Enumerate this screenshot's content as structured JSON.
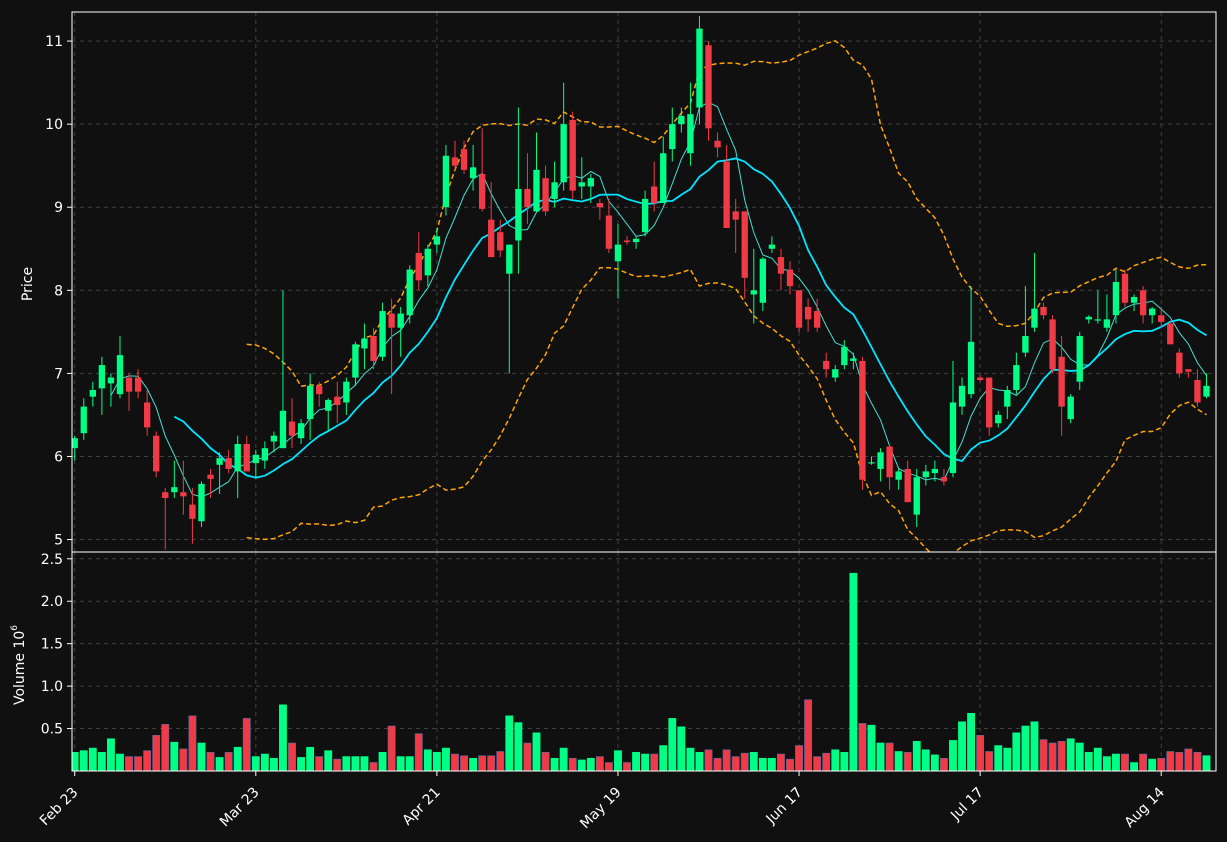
{
  "colors": {
    "background": "#101010",
    "up": "#00ff87",
    "down": "#f03a46",
    "grid": "#555555",
    "axis": "#ffffff",
    "ma_short": "#40e0d0",
    "ma_long": "#00e5ff",
    "band": "#ffa500"
  },
  "chart_data": {
    "type": "candlestick",
    "price_panel": {
      "ylabel": "Price",
      "ylim": [
        4.85,
        11.35
      ],
      "yticks": [
        5,
        6,
        7,
        8,
        9,
        10,
        11
      ],
      "grid": true
    },
    "volume_panel": {
      "ylabel": "Volume",
      "ylabel_exponent": "6",
      "ylim": [
        0,
        2.58
      ],
      "yticks": [
        0.5,
        1.0,
        1.5,
        2.0,
        2.5
      ],
      "grid": true
    },
    "x_ticks": [
      {
        "label": "Feb 23",
        "index": 0
      },
      {
        "label": "Mar 23",
        "index": 20
      },
      {
        "label": "Apr 21",
        "index": 40
      },
      {
        "label": "May 19",
        "index": 60
      },
      {
        "label": "Jun 17",
        "index": 80
      },
      {
        "label": "Jul 17",
        "index": 100
      },
      {
        "label": "Aug 14",
        "index": 120
      }
    ],
    "ohlcv": [
      [
        6.1,
        6.25,
        5.95,
        6.22,
        0.22
      ],
      [
        6.28,
        6.7,
        6.2,
        6.6,
        0.24
      ],
      [
        6.72,
        6.9,
        6.6,
        6.8,
        0.27
      ],
      [
        6.82,
        7.2,
        6.5,
        7.1,
        0.22
      ],
      [
        6.88,
        7.0,
        6.6,
        6.95,
        0.38
      ],
      [
        6.75,
        7.45,
        6.7,
        7.22,
        0.2
      ],
      [
        6.95,
        7.0,
        6.55,
        6.78,
        0.17
      ],
      [
        6.95,
        7.05,
        6.7,
        6.78,
        0.17
      ],
      [
        6.65,
        6.8,
        6.25,
        6.35,
        0.24
      ],
      [
        6.25,
        6.3,
        5.75,
        5.82,
        0.42
      ],
      [
        5.57,
        5.62,
        4.88,
        5.5,
        0.55
      ],
      [
        5.57,
        5.95,
        5.5,
        5.63,
        0.34
      ],
      [
        5.57,
        5.95,
        5.3,
        5.52,
        0.26
      ],
      [
        5.42,
        5.62,
        4.95,
        5.25,
        0.65
      ],
      [
        5.22,
        5.7,
        5.15,
        5.67,
        0.33
      ],
      [
        5.78,
        5.85,
        5.5,
        5.73,
        0.22
      ],
      [
        5.9,
        6.05,
        5.55,
        5.98,
        0.16
      ],
      [
        5.98,
        6.08,
        5.8,
        5.85,
        0.22
      ],
      [
        5.82,
        6.25,
        5.5,
        6.15,
        0.28
      ],
      [
        6.15,
        6.25,
        5.85,
        5.82,
        0.62
      ],
      [
        5.92,
        6.08,
        5.75,
        6.02,
        0.17
      ],
      [
        5.95,
        6.18,
        5.85,
        6.1,
        0.2
      ],
      [
        6.18,
        6.3,
        6.05,
        6.25,
        0.15
      ],
      [
        6.1,
        8.0,
        6.1,
        6.55,
        0.78
      ],
      [
        6.42,
        6.7,
        6.1,
        6.25,
        0.33
      ],
      [
        6.22,
        6.45,
        6.15,
        6.4,
        0.16
      ],
      [
        6.45,
        7.0,
        6.2,
        6.85,
        0.28
      ],
      [
        6.85,
        6.9,
        6.6,
        6.75,
        0.17
      ],
      [
        6.55,
        6.7,
        6.3,
        6.68,
        0.24
      ],
      [
        6.72,
        6.9,
        6.4,
        6.62,
        0.14
      ],
      [
        6.65,
        6.95,
        6.5,
        6.9,
        0.17
      ],
      [
        6.95,
        7.38,
        6.85,
        7.35,
        0.17
      ],
      [
        7.3,
        7.6,
        7.05,
        7.42,
        0.17
      ],
      [
        7.45,
        7.55,
        7.05,
        7.15,
        0.1
      ],
      [
        7.2,
        7.85,
        7.15,
        7.75,
        0.22
      ],
      [
        7.72,
        7.9,
        6.75,
        7.55,
        0.53
      ],
      [
        7.55,
        7.8,
        7.2,
        7.72,
        0.17
      ],
      [
        7.7,
        8.3,
        7.6,
        8.25,
        0.17
      ],
      [
        8.45,
        8.7,
        8.0,
        8.12,
        0.44
      ],
      [
        8.18,
        8.55,
        8.05,
        8.5,
        0.25
      ],
      [
        8.55,
        8.75,
        8.45,
        8.65,
        0.22
      ],
      [
        9.0,
        9.75,
        8.9,
        9.62,
        0.27
      ],
      [
        9.6,
        9.8,
        9.45,
        9.5,
        0.2
      ],
      [
        9.7,
        9.8,
        9.4,
        9.45,
        0.18
      ],
      [
        9.35,
        9.75,
        9.2,
        9.48,
        0.15
      ],
      [
        9.4,
        9.95,
        8.95,
        8.98,
        0.18
      ],
      [
        8.85,
        9.3,
        8.4,
        8.4,
        0.18
      ],
      [
        8.7,
        8.85,
        8.4,
        8.48,
        0.23
      ],
      [
        8.2,
        8.55,
        7.0,
        8.55,
        0.65
      ],
      [
        8.6,
        10.2,
        8.2,
        9.22,
        0.57
      ],
      [
        9.22,
        9.65,
        8.8,
        9.0,
        0.33
      ],
      [
        8.95,
        9.9,
        8.95,
        9.45,
        0.45
      ],
      [
        9.35,
        9.5,
        8.9,
        8.95,
        0.22
      ],
      [
        9.1,
        9.55,
        9.0,
        9.3,
        0.15
      ],
      [
        9.3,
        10.5,
        9.2,
        10.0,
        0.27
      ],
      [
        10.05,
        10.15,
        9.1,
        9.2,
        0.15
      ],
      [
        9.25,
        9.6,
        9.1,
        9.3,
        0.13
      ],
      [
        9.25,
        9.4,
        9.05,
        9.35,
        0.15
      ],
      [
        9.05,
        9.1,
        8.85,
        9.0,
        0.17
      ],
      [
        8.9,
        9.1,
        8.45,
        8.5,
        0.1
      ],
      [
        8.35,
        8.8,
        7.9,
        8.55,
        0.24
      ],
      [
        8.6,
        8.65,
        8.55,
        8.58,
        0.1
      ],
      [
        8.58,
        8.65,
        8.5,
        8.62,
        0.22
      ],
      [
        8.7,
        9.2,
        8.65,
        9.1,
        0.2
      ],
      [
        9.25,
        9.55,
        8.95,
        9.05,
        0.2
      ],
      [
        9.05,
        9.85,
        9.05,
        9.65,
        0.3
      ],
      [
        9.7,
        10.2,
        9.55,
        10.0,
        0.62
      ],
      [
        10.0,
        10.2,
        9.9,
        10.1,
        0.52
      ],
      [
        9.65,
        10.5,
        9.5,
        10.12,
        0.27
      ],
      [
        10.2,
        11.3,
        10.0,
        11.15,
        0.22
      ],
      [
        10.95,
        11.0,
        9.8,
        9.95,
        0.25
      ],
      [
        9.8,
        9.9,
        9.6,
        9.72,
        0.15
      ],
      [
        9.55,
        9.75,
        8.75,
        8.75,
        0.25
      ],
      [
        8.95,
        9.1,
        8.45,
        8.85,
        0.17
      ],
      [
        8.95,
        8.95,
        7.9,
        8.15,
        0.21
      ],
      [
        7.95,
        8.5,
        7.6,
        8.0,
        0.22
      ],
      [
        7.85,
        8.4,
        7.75,
        8.38,
        0.15
      ],
      [
        8.5,
        8.65,
        8.45,
        8.55,
        0.15
      ],
      [
        8.4,
        8.5,
        8.0,
        8.2,
        0.2
      ],
      [
        8.25,
        8.35,
        7.95,
        8.05,
        0.14
      ],
      [
        8.0,
        8.0,
        7.5,
        7.55,
        0.3
      ],
      [
        7.8,
        7.9,
        7.5,
        7.65,
        0.84
      ],
      [
        7.75,
        7.9,
        7.5,
        7.55,
        0.17
      ],
      [
        7.15,
        7.25,
        6.95,
        7.05,
        0.21
      ],
      [
        6.95,
        7.1,
        6.9,
        7.05,
        0.25
      ],
      [
        7.1,
        7.4,
        7.05,
        7.32,
        0.22
      ],
      [
        7.15,
        7.25,
        7.05,
        7.18,
        2.33
      ],
      [
        7.15,
        7.2,
        5.6,
        5.72,
        0.56
      ],
      [
        5.92,
        6.0,
        5.9,
        5.93,
        0.54
      ],
      [
        5.85,
        6.1,
        5.7,
        6.05,
        0.33
      ],
      [
        6.12,
        6.15,
        5.6,
        5.75,
        0.33
      ],
      [
        5.72,
        5.85,
        5.6,
        5.82,
        0.23
      ],
      [
        5.85,
        5.95,
        5.45,
        5.45,
        0.22
      ],
      [
        5.3,
        5.85,
        5.15,
        5.75,
        0.35
      ],
      [
        5.75,
        5.9,
        5.65,
        5.82,
        0.25
      ],
      [
        5.8,
        5.95,
        5.7,
        5.85,
        0.19
      ],
      [
        5.75,
        5.85,
        5.65,
        5.7,
        0.15
      ],
      [
        5.8,
        7.15,
        5.75,
        6.65,
        0.36
      ],
      [
        6.6,
        6.95,
        6.5,
        6.85,
        0.58
      ],
      [
        6.75,
        8.05,
        6.7,
        7.38,
        0.68
      ],
      [
        6.95,
        6.98,
        6.9,
        6.92,
        0.42
      ],
      [
        6.95,
        6.95,
        6.25,
        6.35,
        0.23
      ],
      [
        6.4,
        6.55,
        6.35,
        6.5,
        0.3
      ],
      [
        6.6,
        6.85,
        6.45,
        6.8,
        0.27
      ],
      [
        6.8,
        7.25,
        6.75,
        7.1,
        0.45
      ],
      [
        7.25,
        8.05,
        7.2,
        7.45,
        0.53
      ],
      [
        7.55,
        8.45,
        7.5,
        7.78,
        0.58
      ],
      [
        7.8,
        7.85,
        7.65,
        7.7,
        0.37
      ],
      [
        7.65,
        7.7,
        7.0,
        7.05,
        0.33
      ],
      [
        7.2,
        7.45,
        6.25,
        6.6,
        0.35
      ],
      [
        6.45,
        6.75,
        6.4,
        6.72,
        0.38
      ],
      [
        6.9,
        7.5,
        6.8,
        7.45,
        0.33
      ],
      [
        7.65,
        7.7,
        7.6,
        7.68,
        0.22
      ],
      [
        7.65,
        8.0,
        7.6,
        7.65,
        0.27
      ],
      [
        7.55,
        7.95,
        7.5,
        7.65,
        0.17
      ],
      [
        7.7,
        8.25,
        7.6,
        8.1,
        0.2
      ],
      [
        8.2,
        8.25,
        7.8,
        7.85,
        0.2
      ],
      [
        7.85,
        7.95,
        7.75,
        7.92,
        0.1
      ],
      [
        8.0,
        8.05,
        7.6,
        7.7,
        0.2
      ],
      [
        7.7,
        7.8,
        7.6,
        7.78,
        0.14
      ],
      [
        7.7,
        7.8,
        7.55,
        7.62,
        0.15
      ],
      [
        7.6,
        7.62,
        7.35,
        7.35,
        0.23
      ],
      [
        7.25,
        7.3,
        6.95,
        7.0,
        0.22
      ],
      [
        7.05,
        7.05,
        6.95,
        7.02,
        0.26
      ],
      [
        6.92,
        7.05,
        6.6,
        6.65,
        0.22
      ],
      [
        6.72,
        7.0,
        6.7,
        6.85,
        0.18
      ]
    ],
    "indicators": {
      "ma_short_window": 5,
      "ma_long_window": 12,
      "bollinger_window": 20,
      "bollinger_std": 2
    }
  }
}
